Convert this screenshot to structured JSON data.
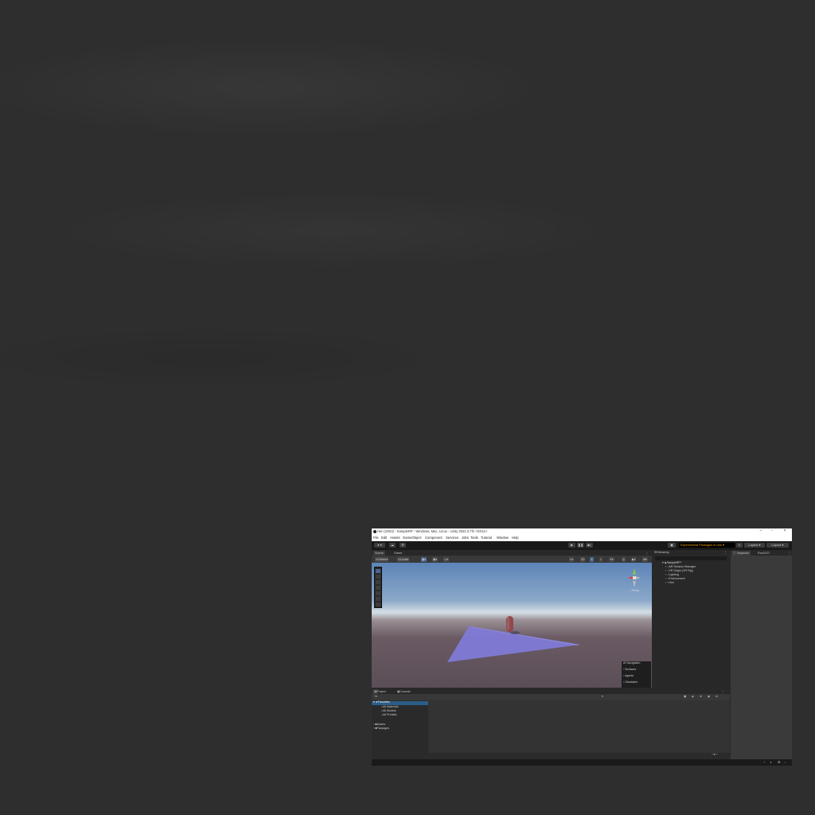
{
  "window": {
    "title": "Hen (2023) - SampleRP - Windows, Mac, Linux - Unity 2022.3.7f1 <DX11>",
    "minimize_icon": "minimize-icon",
    "maximize_icon": "maximize-icon",
    "close_icon": "close-icon"
  },
  "menu": [
    "File",
    "Edit",
    "Assets",
    "GameObject",
    "Component",
    "Services",
    "Jobs",
    "Tools",
    "Tutorial",
    "Window",
    "Help"
  ],
  "toolbar": {
    "experimental_packages": "Experimental Packages In Use ▾",
    "layers": "Layers",
    "layout": "Layout",
    "play_icon": "play-icon",
    "pause_icon": "pause-icon",
    "step_icon": "step-icon"
  },
  "scene": {
    "tab_scene": "Scene",
    "tab_game": "Game",
    "center_toggle": "Center",
    "local_toggle": "Local",
    "mode_2d": "2D",
    "gizmo_label": "< Persp"
  },
  "overlay": {
    "header": "AI Navigation",
    "items": [
      "Surfaces",
      "Agents",
      "Obstacles"
    ]
  },
  "hierarchy": {
    "tab": "Hierarchy",
    "items": [
      "SampleRP*",
      "AR Session Manager",
      "XR Origin (XR Rig)",
      "Lighting",
      "Environment",
      "Hen"
    ]
  },
  "inspector": {
    "tab_inspector": "Inspector",
    "tab_rosgo": "Ros2GO"
  },
  "project": {
    "tab_project": "Project",
    "tab_console": "Console",
    "favorites": "Favorites",
    "favorites_items": [
      "All Materials",
      "All Models",
      "All Prefabs"
    ],
    "assets": "Assets",
    "packages": "Packages"
  },
  "colors": {
    "accent_selection": "#2c5d87",
    "experimental_text": "#f0a000",
    "desktop": "#2e2e2e"
  }
}
